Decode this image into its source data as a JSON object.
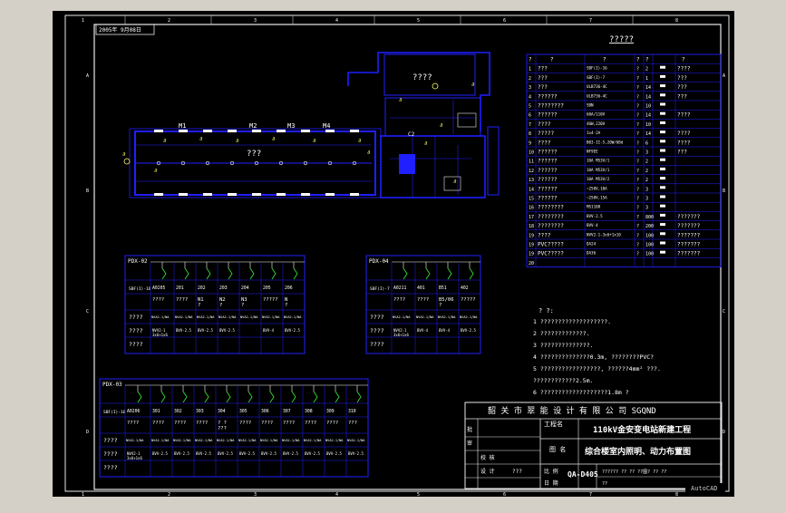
{
  "drawing": {
    "date_stamp": "2005年 9月08日",
    "app_badge": "AutoCAD",
    "colors": {
      "background": "#000000",
      "frame": "#ffffff",
      "wiring": "#1f1fff",
      "symbol": "#ffff66",
      "breaker": "#33dd33",
      "chrome": "#d4d0c8"
    },
    "zone_numbers": [
      "1",
      "2",
      "3",
      "4",
      "5",
      "6",
      "7",
      "8"
    ],
    "zone_letters": [
      "A",
      "B",
      "C",
      "D"
    ]
  },
  "floorplan": {
    "room_label": "???",
    "upper_room_label": "????",
    "window_labels": [
      "M1",
      "M2",
      "M3",
      "M4",
      "C2"
    ]
  },
  "legend": {
    "title": "?????",
    "headers": [
      "?",
      "?",
      "?",
      "?",
      "?",
      "?"
    ],
    "rows": [
      {
        "no": "1",
        "name": "???",
        "model": "SBF(I)-16",
        "a": "?",
        "b": "2",
        "note": "????"
      },
      {
        "no": "2",
        "name": "???",
        "model": "SBF(I)-7",
        "a": "?",
        "b": "1",
        "note": "???"
      },
      {
        "no": "3",
        "name": "???",
        "model": "ULB736-4C",
        "a": "?",
        "b": "14",
        "note": "???"
      },
      {
        "no": "4",
        "name": "??????",
        "model": "ULB736-4C",
        "a": "?",
        "b": "14",
        "note": "???"
      },
      {
        "no": "5",
        "name": "????????",
        "model": "SBN",
        "a": "?",
        "b": "10",
        "note": ""
      },
      {
        "no": "6",
        "name": "??????",
        "model": "60A/110V",
        "a": "?",
        "b": "14",
        "note": "????"
      },
      {
        "no": "7",
        "name": "????",
        "model": "40W,220V",
        "a": "?",
        "b": "10",
        "note": ""
      },
      {
        "no": "8",
        "name": "?????",
        "model": "1x4-2A",
        "a": "?",
        "b": "14",
        "note": "????"
      },
      {
        "no": "9",
        "name": "????",
        "model": "B03-II-5,20W/6Bd",
        "a": "?",
        "b": "6",
        "note": "????"
      },
      {
        "no": "10",
        "name": "??????",
        "model": "NF9EE",
        "a": "?",
        "b": "3",
        "note": "???"
      },
      {
        "no": "11",
        "name": "??????",
        "model": "10A M53V/1",
        "a": "?",
        "b": "2",
        "note": ""
      },
      {
        "no": "12",
        "name": "??????",
        "model": "10A M53V/1",
        "a": "?",
        "b": "2",
        "note": ""
      },
      {
        "no": "13",
        "name": "??????",
        "model": "10A M53V/2",
        "a": "?",
        "b": "2",
        "note": ""
      },
      {
        "no": "14",
        "name": "??????",
        "model": "~250V,10A",
        "a": "?",
        "b": "3",
        "note": ""
      },
      {
        "no": "15",
        "name": "??????",
        "model": "~250V,15A",
        "a": "?",
        "b": "3",
        "note": ""
      },
      {
        "no": "16",
        "name": "????????",
        "model": "MS1108",
        "a": "?",
        "b": "3",
        "note": ""
      },
      {
        "no": "17",
        "name": "????????",
        "model": "BVV-2.5",
        "a": "?",
        "b": "800",
        "note": "???????"
      },
      {
        "no": "18",
        "name": "????????",
        "model": "BVV-4",
        "a": "?",
        "b": "200",
        "note": "???????"
      },
      {
        "no": "19",
        "name": "????",
        "model": "NVV2-1-3x6+1x10",
        "a": "?",
        "b": "100",
        "note": "???????"
      },
      {
        "no": "19",
        "name": "PVC?????",
        "model": "DA24",
        "a": "?",
        "b": "100",
        "note": "???????"
      },
      {
        "no": "19",
        "name": "PVC?????",
        "model": "DA36",
        "a": "?",
        "b": "100",
        "note": "???????"
      },
      {
        "no": "20",
        "name": "",
        "model": "",
        "a": "",
        "b": "",
        "note": ""
      }
    ]
  },
  "notes": {
    "heading": "?  ?:",
    "lines": [
      "1  ???????????????????.",
      "2  ?????????????.",
      "3  ??????????????.",
      "4  ??????????????0.3m,         ????????PVC?",
      "5  ?????????????????, ??????4mm²       ???.",
      "    ????????????2.5m.",
      "6  ???????????????????1.8m        ?"
    ]
  },
  "panels": [
    {
      "id": "PDX-02",
      "panel_model": "SBF(I)-16",
      "circuits": [
        "A0205",
        "201",
        "202",
        "203",
        "204",
        "205",
        "206"
      ],
      "purpose": [
        "????",
        "????",
        "N1\n?",
        "N2\n?",
        "N3\n?",
        "?????",
        "N\n?"
      ],
      "cables": [
        "NVA2-1/NA",
        "NVA2-1/NA",
        "NVA2-1/NA",
        "NVA2-1/NA",
        "NVA2-1/NA",
        "NVA2-1/NA",
        "NVA2-1/NA"
      ],
      "wires": [
        "NVV2-1\n3x6+1x6",
        "BVV-2.5",
        "BVV-2.5",
        "BVV-2.5",
        "",
        "BVV-4",
        "BVV-2.5"
      ]
    },
    {
      "id": "PDX-04",
      "panel_model": "SBF(I)-7",
      "circuits": [
        "A0211",
        "401",
        "B51\n?",
        "402"
      ],
      "purpose": [
        "????",
        "????",
        "B5/06\n?",
        "?????"
      ],
      "cables": [
        "NVA2-1/NA",
        "NVA2-1/NA",
        "NVA2-1/NA",
        "NVA2-1/NA"
      ],
      "wires": [
        "NVV2-1\n3x6+1x6",
        "BVV-4",
        "BVV-4",
        "BVV-2.5"
      ]
    },
    {
      "id": "PDX-03",
      "panel_model": "SBF(I)-16",
      "circuits": [
        "A0206",
        "301",
        "302",
        "303",
        "304",
        "305",
        "306",
        "307",
        "308",
        "309",
        "310"
      ],
      "purpose": [
        "????",
        "????",
        "????",
        "????",
        "? ?\n???",
        "????",
        "????",
        "????",
        "????",
        "????",
        "???"
      ],
      "cables": [
        "NVA2-1/NA",
        "NVA2-1/NA",
        "NVA2-1/NA",
        "NVA2-1/NA",
        "NVA2-1/NA",
        "NVA2-1/NA",
        "NVA2-1/NA",
        "NVA2-1/NA",
        "NVA2-1/NA",
        "NVA2-1/NA",
        "NVA2-1/NA"
      ],
      "wires": [
        "NVV2-1\n3x6+1x6",
        "BVV-2.5",
        "BVV-2.5",
        "BVV-2.5",
        "BVV-2.5",
        "BVV-2.5",
        "BVV-2.5",
        "BVV-2.5",
        "BVV-2.5",
        "BVV-2.5",
        "BVV-2.5"
      ]
    }
  ],
  "panel_row_labels": [
    "????",
    "????",
    "????"
  ],
  "titleblock": {
    "company": "韶 关 市 翠 能 设 计 有 限 公 司   SGQND",
    "project_label": "工程名",
    "project": "110kV金安变电站新建工程",
    "drawing_label": "图 名",
    "drawing_name": "综合楼室内照明、动力布置图",
    "drawing_no": "QA-D405",
    "left_labels": [
      "批",
      "审",
      "校   核",
      "设   计"
    ],
    "left_values": [
      "",
      "",
      "",
      "???"
    ],
    "sub_labels": [
      "比 例",
      "日 期"
    ],
    "sub_values": [
      "",
      "??"
    ],
    "bottom_row": "?????? ?? ?? ??图? ?? ??"
  }
}
